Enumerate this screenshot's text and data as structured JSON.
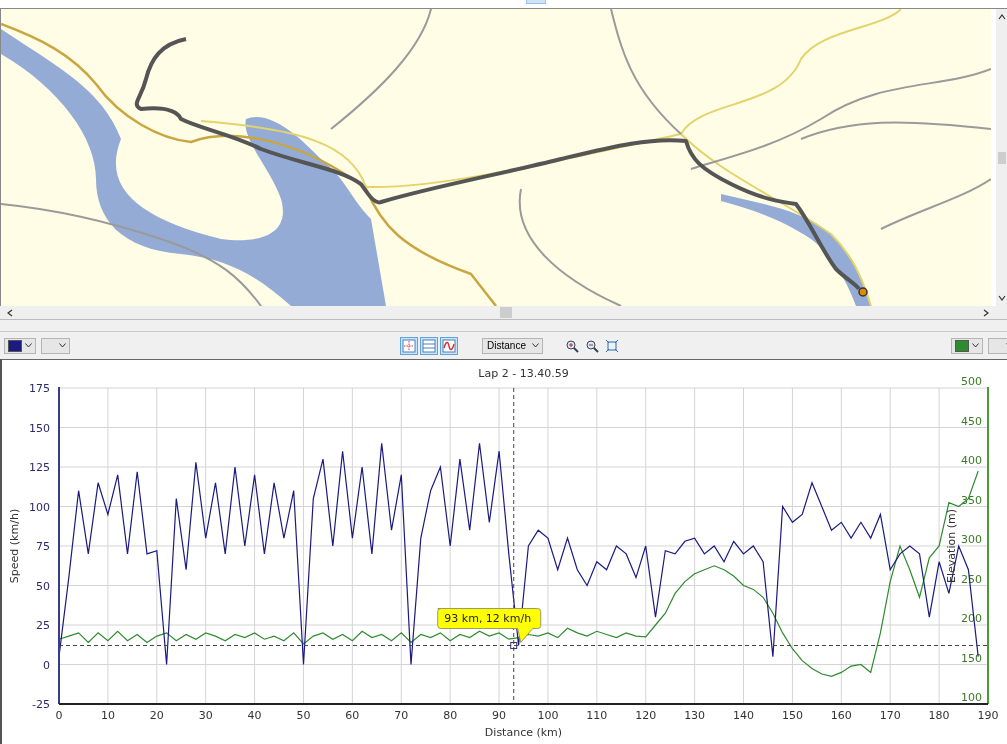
{
  "toolbar": {
    "view_buttons": [
      {
        "kind": "crosshair",
        "selected": true
      },
      {
        "kind": "split",
        "selected": true
      },
      {
        "kind": "wave",
        "selected": true
      }
    ],
    "x_axis_select": {
      "value": "Distance"
    },
    "zoom_buttons": [
      {
        "kind": "zoom-in"
      },
      {
        "kind": "zoom-out"
      },
      {
        "kind": "fit"
      }
    ]
  },
  "chart": {
    "chart_data": {
      "type": "line",
      "title": "Lap 2 - 13.40.59",
      "xlabel": "Distance (km)",
      "ylabel": "Speed (km/h)",
      "y2label": "Elevation (m)",
      "x": [
        0,
        2,
        4,
        6,
        8,
        10,
        12,
        14,
        16,
        18,
        20,
        22,
        24,
        26,
        28,
        30,
        32,
        34,
        36,
        38,
        40,
        42,
        44,
        46,
        48,
        50,
        52,
        54,
        56,
        58,
        60,
        62,
        64,
        66,
        68,
        70,
        72,
        74,
        76,
        78,
        80,
        82,
        84,
        86,
        88,
        90,
        92,
        94,
        96,
        98,
        100,
        102,
        104,
        106,
        108,
        110,
        112,
        114,
        116,
        118,
        120,
        122,
        124,
        126,
        128,
        130,
        132,
        134,
        136,
        138,
        140,
        142,
        144,
        146,
        148,
        150,
        152,
        154,
        156,
        158,
        160,
        162,
        164,
        166,
        168,
        170,
        172,
        174,
        176,
        178,
        180,
        182,
        184,
        186,
        188
      ],
      "series": [
        {
          "color": "#1a1a80",
          "values": [
            5,
            55,
            110,
            70,
            115,
            95,
            120,
            70,
            122,
            70,
            72,
            0,
            105,
            60,
            128,
            80,
            115,
            70,
            125,
            75,
            120,
            70,
            115,
            80,
            110,
            0,
            105,
            130,
            75,
            135,
            80,
            125,
            70,
            140,
            85,
            120,
            0,
            80,
            110,
            125,
            75,
            130,
            85,
            140,
            90,
            135,
            70,
            12,
            75,
            85,
            80,
            60,
            80,
            60,
            50,
            65,
            60,
            75,
            70,
            55,
            75,
            30,
            72,
            70,
            78,
            80,
            70,
            75,
            65,
            78,
            70,
            75,
            65,
            5,
            100,
            90,
            95,
            115,
            100,
            85,
            90,
            80,
            90,
            80,
            95,
            60,
            70,
            75,
            70,
            30,
            65,
            45,
            75,
            60,
            5
          ]
        },
        {
          "color": "#2e8b2e",
          "axis": "y2",
          "values": [
            182,
            186,
            190,
            178,
            190,
            180,
            192,
            180,
            188,
            178,
            186,
            190,
            180,
            188,
            182,
            190,
            186,
            180,
            188,
            184,
            190,
            182,
            186,
            180,
            190,
            176,
            186,
            190,
            182,
            188,
            180,
            192,
            184,
            188,
            180,
            190,
            178,
            188,
            184,
            190,
            180,
            188,
            184,
            192,
            186,
            190,
            182,
            184,
            188,
            186,
            190,
            184,
            196,
            190,
            186,
            192,
            188,
            184,
            190,
            186,
            185,
            200,
            215,
            240,
            255,
            265,
            270,
            275,
            270,
            262,
            250,
            245,
            235,
            215,
            190,
            170,
            155,
            145,
            138,
            135,
            140,
            148,
            150,
            140,
            190,
            255,
            300,
            270,
            235,
            285,
            300,
            355,
            350,
            360,
            395
          ]
        }
      ],
      "xlim": [
        0,
        190
      ],
      "ylim": [
        -25,
        175
      ],
      "y2lim": [
        100,
        500
      ],
      "xticks": [
        0,
        10,
        20,
        30,
        40,
        50,
        60,
        70,
        80,
        90,
        100,
        110,
        120,
        130,
        140,
        150,
        160,
        170,
        180,
        190
      ],
      "yticks": [
        -25,
        0,
        25,
        50,
        75,
        100,
        125,
        150,
        175
      ],
      "y2ticks": [
        100,
        150,
        200,
        250,
        300,
        350,
        400,
        450,
        500
      ],
      "grid": true,
      "ref_lines": [
        {
          "axis": "y",
          "value": 12
        },
        {
          "axis": "x",
          "value": 93
        }
      ],
      "annotations": [
        {
          "x": 93,
          "y": 12,
          "text": "93 km, 12 km/h"
        }
      ]
    }
  }
}
